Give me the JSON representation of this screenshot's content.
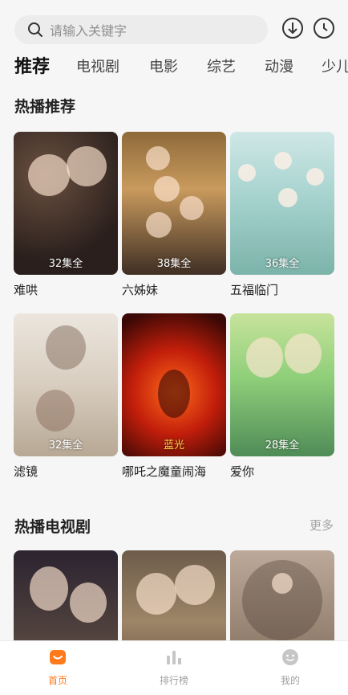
{
  "search": {
    "placeholder": "请输入关键字"
  },
  "header_icons": [
    "download-icon",
    "history-clock-icon"
  ],
  "tabs": [
    {
      "label": "推荐",
      "active": true
    },
    {
      "label": "电视剧",
      "active": false
    },
    {
      "label": "电影",
      "active": false
    },
    {
      "label": "综艺",
      "active": false
    },
    {
      "label": "动漫",
      "active": false
    },
    {
      "label": "少儿",
      "active": false
    }
  ],
  "section_hot": {
    "title": "热播推荐"
  },
  "hot_items": [
    {
      "title": "难哄",
      "badge": "32集全"
    },
    {
      "title": "六姊妹",
      "badge": "38集全"
    },
    {
      "title": "五福临门",
      "badge": "36集全"
    },
    {
      "title": "滤镜",
      "badge": "32集全"
    },
    {
      "title": "哪吒之魔童闹海",
      "badge": "蓝光"
    },
    {
      "title": "爱你",
      "badge": "28集全"
    }
  ],
  "section_tv": {
    "title": "热播电视剧",
    "more": "更多"
  },
  "bottom_nav": [
    {
      "label": "首页",
      "icon": "home-icon",
      "active": true
    },
    {
      "label": "排行榜",
      "icon": "ranking-bars-icon",
      "active": false
    },
    {
      "label": "我的",
      "icon": "profile-face-icon",
      "active": false
    }
  ],
  "colors": {
    "accent": "#ff7a1a",
    "background": "#f6f6f6"
  }
}
